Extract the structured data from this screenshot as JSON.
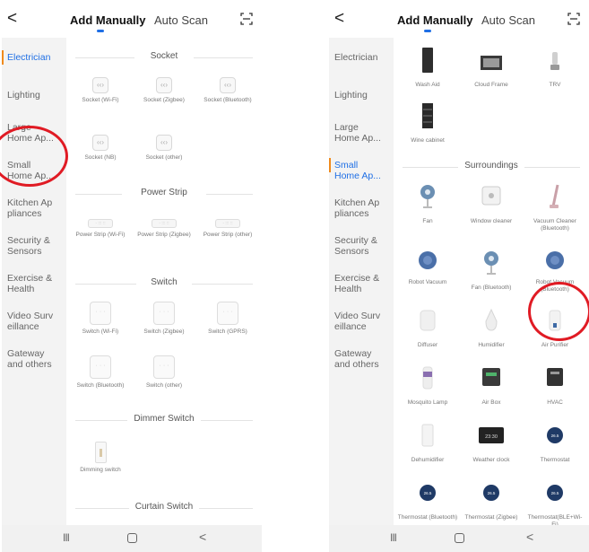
{
  "header": {
    "back_symbol": "<",
    "tab_manual": "Add Manually",
    "tab_auto": "Auto Scan"
  },
  "sidebar": {
    "items": [
      "Electrician",
      "Lighting",
      "Large Home Ap...",
      "Small Home Ap...",
      "Kitchen Ap pliances",
      "Security & Sensors",
      "Exercise & Health",
      "Video Surv eillance",
      "Gateway and others"
    ],
    "active_left": "Electrician",
    "active_right": "Small Home Ap..."
  },
  "left_panel": {
    "sections": [
      {
        "title": "Socket",
        "items": [
          "Socket (Wi-Fi)",
          "Socket (Zigbee)",
          "Socket (Bluetooth)",
          "Socket (NB)",
          "Socket (other)"
        ]
      },
      {
        "title": "Power Strip",
        "items": [
          "Power Strip (Wi-Fi)",
          "Power Strip (Zigbee)",
          "Power Strip (other)"
        ]
      },
      {
        "title": "Switch",
        "items": [
          "Switch (Wi-Fi)",
          "Switch (Zigbee)",
          "Switch (GPRS)",
          "Switch (Bluetooth)",
          "Switch (other)"
        ]
      },
      {
        "title": "Dimmer Switch",
        "items": [
          "Dimming switch"
        ]
      },
      {
        "title": "Curtain Switch",
        "items": []
      }
    ]
  },
  "right_panel": {
    "top_items": [
      "Wash Aid",
      "Cloud Frame",
      "TRV",
      "Wine cabinet"
    ],
    "section_title": "Surroundings",
    "items": [
      "Fan",
      "Window cleaner",
      "Vacuum Cleaner (Bluetooth)",
      "Robot Vacuum",
      "Fan (Bluetooth)",
      "Robot Vacuum (Bluetooth)",
      "Diffuser",
      "Humidifier",
      "Air Purifier",
      "Mosquito Lamp",
      "Air Box",
      "HVAC",
      "Dehumidifier",
      "Weather clock",
      "Thermostat",
      "Thermostat (Bluetooth)",
      "Thermostat (Zigbee)",
      "Thermostat(BLE+Wi-Fi)"
    ]
  },
  "device_glyphs": {
    "socket": "‹‹›",
    "strip": "· ::: ::",
    "switch": "· · ·",
    "clock_time": "23:30",
    "thermo_value": "26.5"
  },
  "navbar": {
    "recent": "III",
    "back": "<"
  },
  "colors": {
    "accent_blue": "#1f6fe5",
    "active_marker": "#f08a1c",
    "annotation_red": "#e01b24"
  }
}
